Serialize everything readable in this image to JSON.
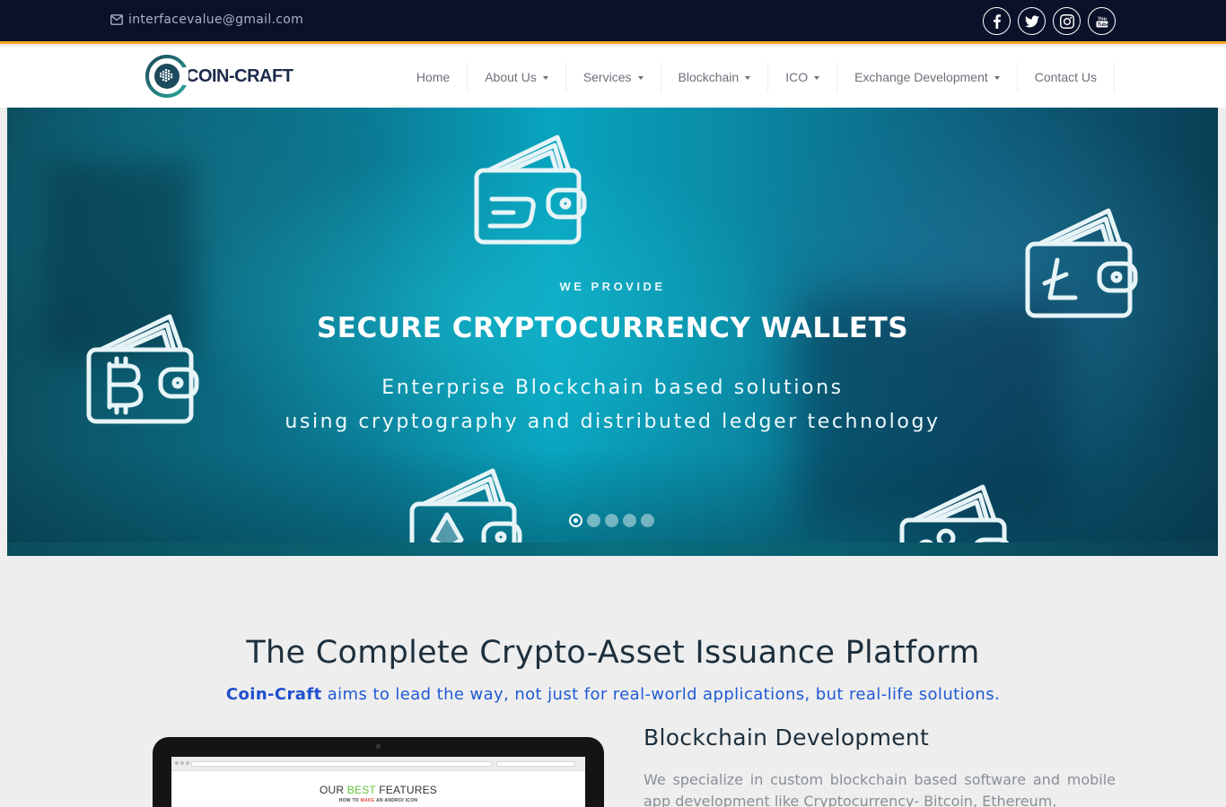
{
  "topbar": {
    "email": "interfacevalue@gmail.com",
    "social": [
      {
        "name": "facebook-icon"
      },
      {
        "name": "twitter-icon"
      },
      {
        "name": "instagram-icon"
      },
      {
        "name": "youtube-icon"
      }
    ]
  },
  "navbar": {
    "logo_text": "COIN-CRAFT",
    "items": [
      {
        "label": "Home",
        "dropdown": false
      },
      {
        "label": "About Us",
        "dropdown": true
      },
      {
        "label": "Services",
        "dropdown": true
      },
      {
        "label": "Blockchain",
        "dropdown": true
      },
      {
        "label": "ICO",
        "dropdown": true
      },
      {
        "label": "Exchange Development",
        "dropdown": true
      },
      {
        "label": "Contact Us",
        "dropdown": false
      }
    ]
  },
  "hero": {
    "kicker": "WE PROVIDE",
    "headline": "SECURE CRYPTOCURRENCY WALLETS",
    "sub_line1": "Enterprise Blockchain based solutions",
    "sub_line2": "using cryptography and distributed ledger technology",
    "slides_count": 5,
    "active_slide": 1,
    "wallet_icons": [
      "dash-wallet-icon",
      "litecoin-wallet-icon",
      "bitcoin-wallet-icon",
      "ethereum-wallet-icon",
      "ripple-wallet-icon"
    ]
  },
  "platform": {
    "title": "The Complete Crypto-Asset Issuance Platform",
    "subtitle_brand": "Coin-Craft",
    "subtitle_rest": " aims to lead the way, not just for real-world applications, but real-life solutions."
  },
  "laptop_screen": {
    "heading_part1": "OUR ",
    "heading_highlight": "BEST",
    "heading_part2": " FEATURES",
    "sub_part1": "HOW TO ",
    "sub_highlight": "MAKE",
    "sub_part2": " AN ANDROI ICON"
  },
  "blockchain": {
    "title": "Blockchain Development",
    "text": "We specialize in custom blockchain based software and mobile app development like Cryptocurrency- Bitcoin, Ethereum,"
  },
  "colors": {
    "topbar_bg": "#0a1128",
    "accent_line": "#f5a623",
    "brand_blue": "#1f5bd3",
    "heading": "#1c2f3d"
  }
}
